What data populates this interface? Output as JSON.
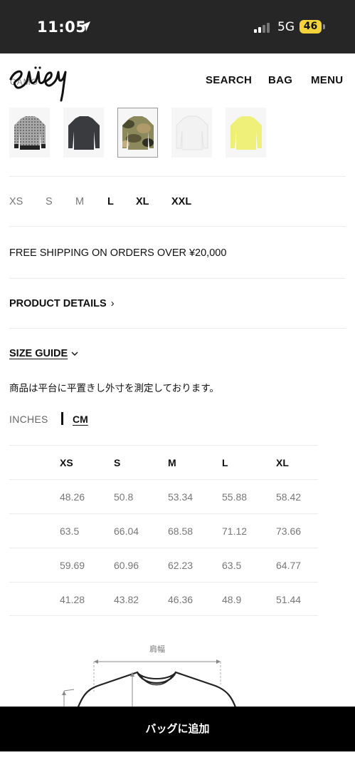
{
  "status": {
    "time": "11:05",
    "network": "5G",
    "battery": "46"
  },
  "header": {
    "brand": "Stüssy",
    "variant_label": "CAMO",
    "nav": {
      "search": "SEARCH",
      "bag": "BAG",
      "menu": "MENU"
    }
  },
  "swatches": [
    {
      "name": "pattern-gray",
      "color": "#9a9a9a"
    },
    {
      "name": "charcoal",
      "color": "#3a3b3f"
    },
    {
      "name": "camo",
      "color": "#7a7a4a",
      "selected": true
    },
    {
      "name": "white",
      "color": "#efefef"
    },
    {
      "name": "lime",
      "color": "#eef07a"
    }
  ],
  "sizes": [
    {
      "label": "XS",
      "available": false
    },
    {
      "label": "S",
      "available": false
    },
    {
      "label": "M",
      "available": false
    },
    {
      "label": "L",
      "available": true
    },
    {
      "label": "XL",
      "available": true
    },
    {
      "label": "XXL",
      "available": true
    }
  ],
  "shipping": "FREE SHIPPING ON ORDERS OVER ¥20,000",
  "product_details": "PRODUCT DETAILS",
  "size_guide": {
    "title": "SIZE GUIDE",
    "note": "商品は平台に平置きし外寸を測定しております。",
    "unit_inches": "INCHES",
    "unit_cm": "CM",
    "columns": [
      "XS",
      "S",
      "M",
      "L",
      "XL"
    ],
    "rows": [
      [
        "48.26",
        "50.8",
        "53.34",
        "55.88",
        "58.42"
      ],
      [
        "63.5",
        "66.04",
        "68.58",
        "71.12",
        "73.66"
      ],
      [
        "59.69",
        "60.96",
        "62.23",
        "63.5",
        "64.77"
      ],
      [
        "41.28",
        "43.82",
        "46.36",
        "48.9",
        "51.44"
      ]
    ],
    "diagram_label": "肩幅"
  },
  "cta": {
    "add_to_bag": "バッグに追加"
  }
}
